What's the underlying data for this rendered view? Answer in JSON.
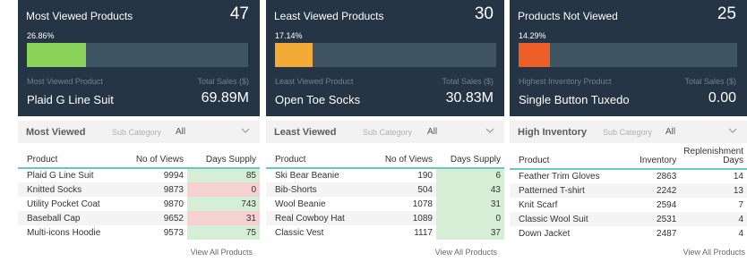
{
  "colors": {
    "card_bg": "#263545",
    "bar_track": "#3f5563",
    "header_rule": "#67c8c0",
    "good": "#d5eed5",
    "bad": "#f6d1d1"
  },
  "panels": [
    {
      "id": "most-viewed",
      "card": {
        "title": "Most Viewed Products",
        "count": "47",
        "percent_label": "26.86%",
        "bar_fraction": 0.2686,
        "bar_color": "#8ad25a",
        "sub_left": "Most Viewed Product",
        "sub_right": "Total Sales ($)",
        "name": "Plaid G Line Suit",
        "value": "69.89M"
      },
      "filter": {
        "title": "Most Viewed",
        "label": "Sub Category",
        "value": "All",
        "icon": "chevron-down-icon"
      },
      "columns": [
        "Product",
        "No of Views",
        "Days Supply"
      ],
      "rows": [
        {
          "cells": [
            "Plaid G Line Suit",
            "9994",
            "85"
          ],
          "status": "good"
        },
        {
          "cells": [
            "Knitted Socks",
            "9873",
            "0"
          ],
          "status": "bad"
        },
        {
          "cells": [
            "Utility Pocket Coat",
            "9870",
            "743"
          ],
          "status": "good"
        },
        {
          "cells": [
            "Baseball Cap",
            "9652",
            "31"
          ],
          "status": "bad"
        },
        {
          "cells": [
            "Multi-icons Hoodie",
            "9573",
            "75"
          ],
          "status": "good"
        }
      ],
      "view_all": "View All Products"
    },
    {
      "id": "least-viewed",
      "card": {
        "title": "Least Viewed Products",
        "count": "30",
        "percent_label": "17.14%",
        "bar_fraction": 0.1714,
        "bar_color": "#f2ab37",
        "sub_left": "Least Viewed Product",
        "sub_right": "Total Sales ($)",
        "name": "Open Toe Socks",
        "value": "30.83M"
      },
      "filter": {
        "title": "Least Viewed",
        "label": "Sub Category",
        "value": "All",
        "icon": "chevron-down-icon"
      },
      "columns": [
        "Product",
        "No of Views",
        "Days Supply"
      ],
      "rows": [
        {
          "cells": [
            "Ski Bear Beanie",
            "190",
            "6"
          ],
          "status": "good"
        },
        {
          "cells": [
            "Bib-Shorts",
            "504",
            "43"
          ],
          "status": "good"
        },
        {
          "cells": [
            "Wool Beanie",
            "1078",
            "31"
          ],
          "status": "good"
        },
        {
          "cells": [
            "Real Cowboy Hat",
            "1089",
            "0"
          ],
          "status": "good"
        },
        {
          "cells": [
            "Classic Vest",
            "1117",
            "37"
          ],
          "status": "good"
        }
      ],
      "view_all": "View All Products"
    },
    {
      "id": "not-viewed",
      "card": {
        "title": "Products Not Viewed",
        "count": "25",
        "percent_label": "14.29%",
        "bar_fraction": 0.1429,
        "bar_color": "#ee5e27",
        "sub_left": "Highest Inventory Product",
        "sub_right": "Total Sales ($)",
        "name": "Single Button Tuxedo",
        "value": "0.00"
      },
      "filter": {
        "title": "High Inventory",
        "label": "Sub Category",
        "value": "All",
        "icon": "chevron-down-icon"
      },
      "columns": [
        "Product",
        "Inventory",
        "Replenishment Days"
      ],
      "rows": [
        {
          "cells": [
            "Feather Trim Gloves",
            "2863",
            "14"
          ],
          "status": ""
        },
        {
          "cells": [
            "Patterned T-shirt",
            "2242",
            "13"
          ],
          "status": ""
        },
        {
          "cells": [
            "Knit Scarf",
            "2594",
            "7"
          ],
          "status": ""
        },
        {
          "cells": [
            "Classic Wool Suit",
            "2531",
            "4"
          ],
          "status": ""
        },
        {
          "cells": [
            "Down Jacket",
            "2487",
            "4"
          ],
          "status": ""
        }
      ],
      "view_all": "View All Products"
    }
  ]
}
